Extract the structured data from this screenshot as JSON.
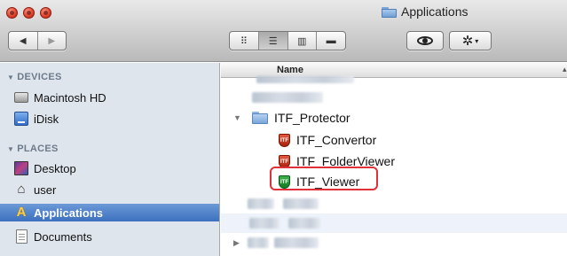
{
  "window": {
    "title": "Applications",
    "title_icon": "folder-icon"
  },
  "toolbar": {
    "back_icon": "◀",
    "forward_icon": "▶",
    "view_icons": [
      "⠿",
      "☰",
      "▥",
      "▬"
    ],
    "view_icon_names": [
      "icon-view",
      "list-view",
      "column-view",
      "cover-flow-view"
    ],
    "active_view": "list-view",
    "quick_look_icon": "eye-icon",
    "action_icon": "✲",
    "action_caret": "▾"
  },
  "sidebar": {
    "devices_heading": "DEVICES",
    "places_heading": "PLACES",
    "devices": [
      {
        "label": "Macintosh HD",
        "icon": "hard-drive-icon"
      },
      {
        "label": "iDisk",
        "icon": "idisk-icon"
      }
    ],
    "places": [
      {
        "label": "Desktop",
        "icon": "desktop-icon"
      },
      {
        "label": "user",
        "icon": "home-icon"
      },
      {
        "label": "Applications",
        "icon": "applications-icon",
        "selected": true
      },
      {
        "label": "Documents",
        "icon": "documents-icon"
      }
    ]
  },
  "list": {
    "column_name": "Name",
    "folder": {
      "label": "ITF_Protector",
      "expanded": true
    },
    "children": [
      {
        "label": "ITF_Convertor",
        "icon": "red-shield-icon",
        "badge": "ITF"
      },
      {
        "label": "ITF_FolderViewer",
        "icon": "red-shield-icon",
        "badge": "ITF"
      },
      {
        "label": "ITF_Viewer",
        "icon": "green-shield-icon",
        "badge": "ITF",
        "highlighted": true
      }
    ]
  },
  "colors": {
    "sidebar_bg": "#dfe5ec",
    "selection": "#3c70bf",
    "highlight_border": "#e0303a",
    "alt_row": "#eef3fb"
  }
}
